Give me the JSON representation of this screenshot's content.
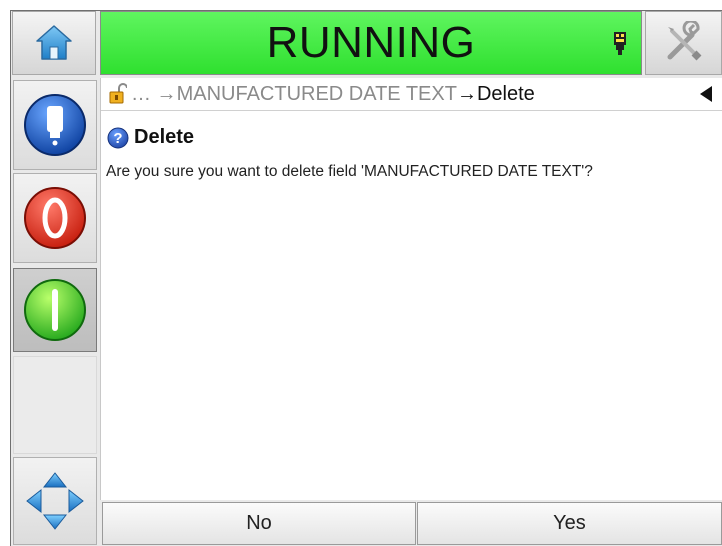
{
  "header": {
    "status_text": "RUNNING",
    "status_color": "#33e633",
    "icons": [
      "home-icon",
      "printhead-icon",
      "tools-icon"
    ]
  },
  "sidebar": {
    "icons": [
      "ink-icon",
      "stop-icon",
      "start-icon",
      "navigation-arrows-icon"
    ]
  },
  "breadcrumb": {
    "ellipsis": "…",
    "field": "MANUFACTURED DATE TEXT",
    "current": "Delete"
  },
  "dialog": {
    "title": "Delete",
    "message": "Are you sure you want to delete field 'MANUFACTURED DATE TEXT'?"
  },
  "buttons": {
    "no": "No",
    "yes": "Yes"
  }
}
